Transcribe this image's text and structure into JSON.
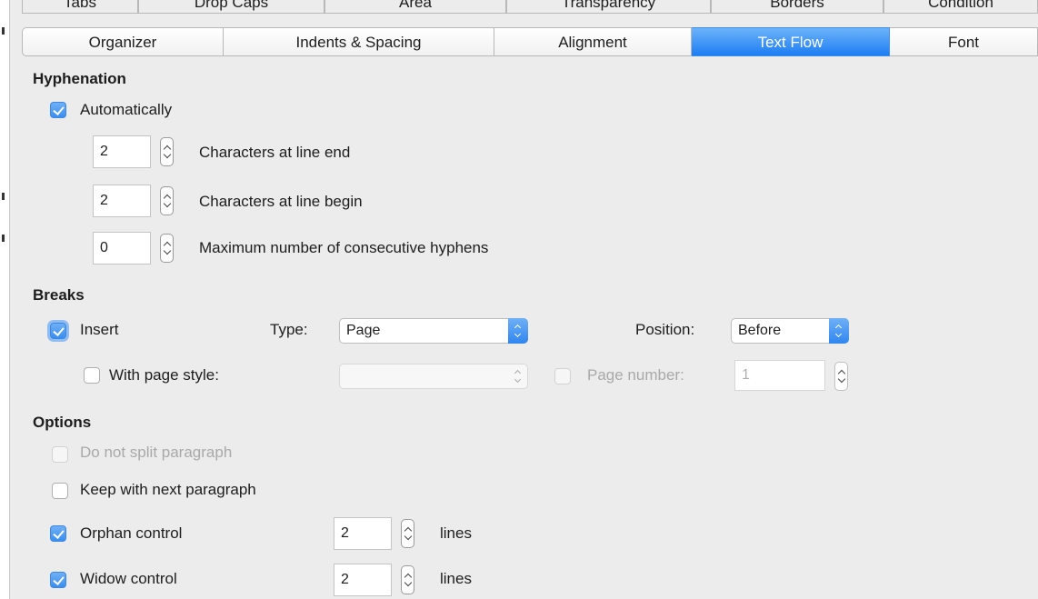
{
  "tabs_top": [
    "Tabs",
    "Drop Caps",
    "Area",
    "Transparency",
    "Borders",
    "Condition"
  ],
  "tabs_bottom": [
    "Organizer",
    "Indents & Spacing",
    "Alignment",
    "Text Flow",
    "Font"
  ],
  "active_tab": "Text Flow",
  "hyphenation": {
    "title": "Hyphenation",
    "automatically": {
      "label": "Automatically",
      "checked": true
    },
    "line_end": {
      "value": "2",
      "label": "Characters at line end"
    },
    "line_begin": {
      "value": "2",
      "label": "Characters at line begin"
    },
    "max_hyphens": {
      "value": "0",
      "label": "Maximum number of consecutive hyphens"
    }
  },
  "breaks": {
    "title": "Breaks",
    "insert": {
      "label": "Insert",
      "checked": true
    },
    "type_label": "Type:",
    "type_value": "Page",
    "position_label": "Position:",
    "position_value": "Before",
    "with_page_style": {
      "label": "With page style:",
      "checked": false
    },
    "page_style_value": "",
    "page_number": {
      "label": "Page number:",
      "value": "1",
      "checked": false
    }
  },
  "options": {
    "title": "Options",
    "do_not_split": {
      "label": "Do not split paragraph",
      "checked": false,
      "enabled": false
    },
    "keep_with_next": {
      "label": "Keep with next paragraph",
      "checked": false
    },
    "orphan": {
      "label": "Orphan control",
      "checked": true,
      "value": "2",
      "unit": "lines"
    },
    "widow": {
      "label": "Widow control",
      "checked": true,
      "value": "2",
      "unit": "lines"
    }
  },
  "colors": {
    "accent": "#1d7df3",
    "background": "#ececec"
  }
}
